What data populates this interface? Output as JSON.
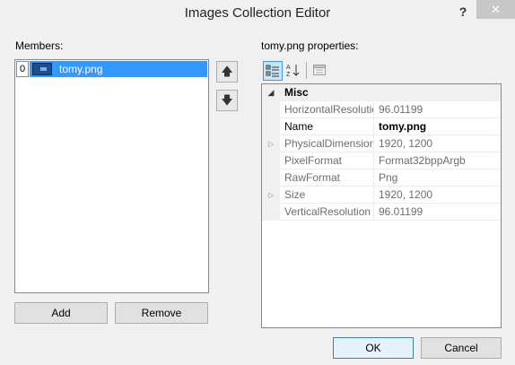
{
  "window": {
    "title": "Images Collection Editor",
    "help_glyph": "?",
    "close_glyph": "✕"
  },
  "members": {
    "label": "Members:",
    "items": [
      {
        "index": "0",
        "name": "tomy.png",
        "selected": true
      }
    ],
    "add_label": "Add",
    "remove_label": "Remove",
    "move_up_glyph": "🡅",
    "move_down_glyph": "🡇"
  },
  "properties": {
    "label": "tomy.png properties:",
    "toolbar": {
      "categorized_icon": "categorized-icon",
      "alphabetical_icon": "alphabetical-icon",
      "property_pages_icon": "property-pages-icon"
    },
    "category": "Misc",
    "rows": [
      {
        "name": "HorizontalResolution",
        "value": "96.01199",
        "expandable": false,
        "readonly": true
      },
      {
        "name": "Name",
        "value": "tomy.png",
        "expandable": false,
        "readonly": false
      },
      {
        "name": "PhysicalDimension",
        "value": "1920, 1200",
        "expandable": true,
        "readonly": true
      },
      {
        "name": "PixelFormat",
        "value": "Format32bppArgb",
        "expandable": false,
        "readonly": true
      },
      {
        "name": "RawFormat",
        "value": "Png",
        "expandable": false,
        "readonly": true
      },
      {
        "name": "Size",
        "value": "1920, 1200",
        "expandable": true,
        "readonly": true
      },
      {
        "name": "VerticalResolution",
        "value": "96.01199",
        "expandable": false,
        "readonly": true
      }
    ]
  },
  "footer": {
    "ok_label": "OK",
    "cancel_label": "Cancel"
  }
}
